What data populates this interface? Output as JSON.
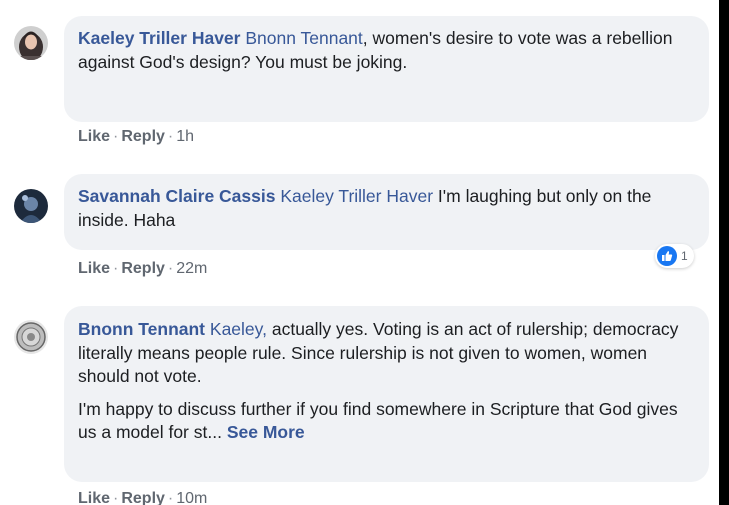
{
  "colors": {
    "name_link": "#385898",
    "bubble_bg": "#f0f2f5",
    "text": "#1c1e21",
    "meta": "#606770",
    "like_blue": "#1877f2"
  },
  "comments": [
    {
      "author": "Kaeley Triller Haver",
      "mention": "Bnonn Tennant",
      "text": ", women's desire to vote was a rebellion against God's design? You must be joking.",
      "actions": {
        "like": "Like",
        "reply": "Reply",
        "time": "1h"
      },
      "avatar_icon": "profile-photo-woman-dark-hair"
    },
    {
      "author": "Savannah Claire Cassis",
      "mention": "Kaeley Triller Haver",
      "text": "I'm laughing but only on the inside. Haha",
      "actions": {
        "like": "Like",
        "reply": "Reply",
        "time": "22m"
      },
      "reaction": {
        "icon": "thumbs-up-icon",
        "count": "1"
      },
      "avatar_icon": "profile-photo-blue-dark"
    },
    {
      "author": "Bnonn Tennant",
      "mention": "Kaeley,",
      "text": "actually yes. Voting is an act of rulership; democracy literally means people rule. Since rulership is not given to women, women should not vote.",
      "text2": "I'm happy to discuss further if you find somewhere in Scripture that God gives us a model for st...",
      "see_more": "See More",
      "actions": {
        "like": "Like",
        "reply": "Reply",
        "time": "10m"
      },
      "avatar_icon": "profile-photo-circular-emblem"
    }
  ]
}
